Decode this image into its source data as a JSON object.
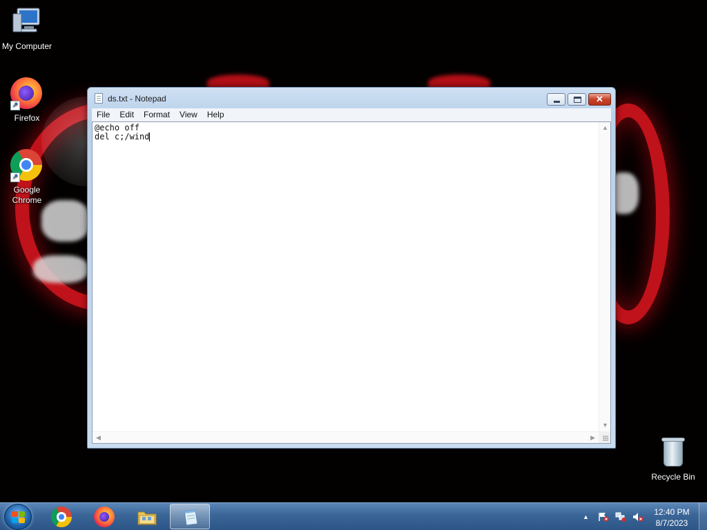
{
  "desktop": {
    "icons": [
      {
        "label": "My Computer",
        "icon": "computer-icon"
      },
      {
        "label": "Firefox",
        "icon": "firefox-icon"
      },
      {
        "label": "Google Chrome",
        "icon": "chrome-icon"
      },
      {
        "label": "Recycle Bin",
        "icon": "recycle-bin-icon"
      }
    ]
  },
  "window": {
    "title": "ds.txt - Notepad",
    "controls": {
      "minimize": "minimize-icon",
      "maximize": "maximize-icon",
      "close": "close-icon"
    },
    "menu": [
      "File",
      "Edit",
      "Format",
      "View",
      "Help"
    ],
    "content": {
      "line1": "@echo off",
      "line2": "del c;/wind"
    }
  },
  "taskbar": {
    "start": "windows-logo-icon",
    "pinned": [
      {
        "name": "Google Chrome",
        "icon": "chrome-icon"
      },
      {
        "name": "Firefox",
        "icon": "firefox-icon"
      },
      {
        "name": "Windows Explorer",
        "icon": "folder-icon"
      },
      {
        "name": "Notepad",
        "icon": "notepad-icon",
        "active": true
      }
    ],
    "tray": {
      "icons": [
        "show-hidden-icons-chevron",
        "action-center-flag-icon",
        "network-icon",
        "volume-muted-icon"
      ],
      "time": "12:40 PM",
      "date": "8/7/2023"
    }
  },
  "colors": {
    "taskbar": "#3a6597",
    "window_frame": "#b9d1ea",
    "close_button": "#c7432a",
    "wallpaper_accent": "#c0121a"
  }
}
